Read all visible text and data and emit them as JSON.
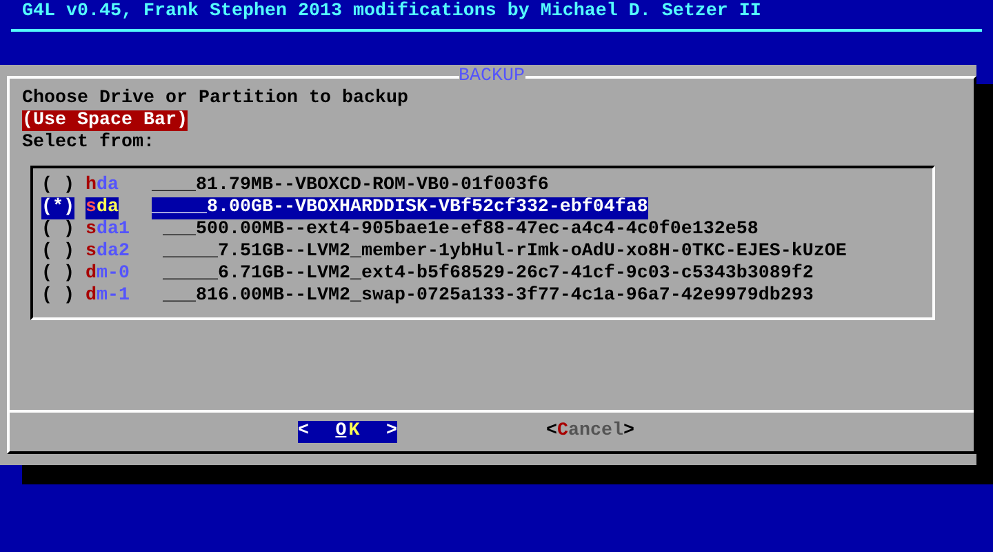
{
  "header": {
    "title": "G4L v0.45, Frank Stephen 2013 modifications by Michael D. Setzer II"
  },
  "dialog": {
    "title": "BACKUP",
    "prompt": "Choose Drive or Partition to backup",
    "hint": "(Use Space Bar)",
    "list_label": "Select from:",
    "items": [
      {
        "marker": "( )",
        "name": "hda",
        "description": "____81.79MB--VBOXCD-ROM-VB0-01f003f6",
        "selected": false
      },
      {
        "marker": "(*)",
        "name": "sda",
        "description": "_____8.00GB--VBOXHARDDISK-VBf52cf332-ebf04fa8",
        "selected": true
      },
      {
        "marker": "( )",
        "name": "sda1",
        "description": "___500.00MB--ext4-905bae1e-ef88-47ec-a4c4-4c0f0e132e58",
        "selected": false
      },
      {
        "marker": "( )",
        "name": "sda2",
        "description": "_____7.51GB--LVM2_member-1ybHul-rImk-oAdU-xo8H-0TKC-EJES-kUzOE",
        "selected": false
      },
      {
        "marker": "( )",
        "name": "dm-0",
        "description": "_____6.71GB--LVM2_ext4-b5f68529-26c7-41cf-9c03-c5343b3089f2",
        "selected": false
      },
      {
        "marker": "( )",
        "name": "dm-1",
        "description": "___816.00MB--LVM2_swap-0725a133-3f77-4c1a-96a7-42e9979db293",
        "selected": false
      }
    ],
    "buttons": [
      {
        "open": "<",
        "label": "OK",
        "close": ">",
        "selected": true
      },
      {
        "open": "<",
        "label": "Cancel",
        "close": ">",
        "selected": false
      }
    ]
  }
}
